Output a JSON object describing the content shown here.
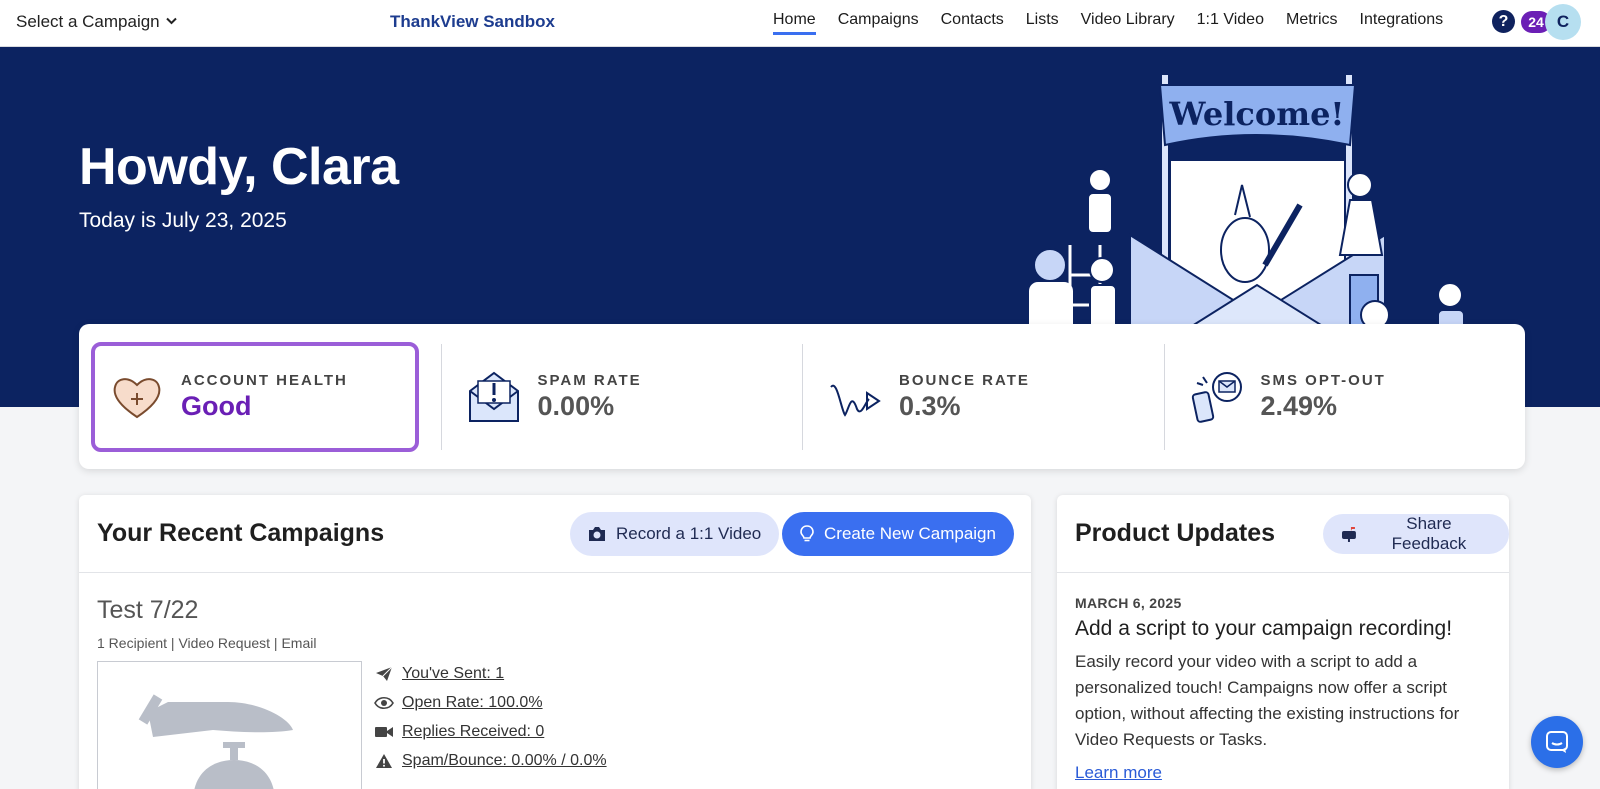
{
  "nav": {
    "campaign_select": "Select a Campaign",
    "brand": "ThankView Sandbox",
    "links": [
      "Home",
      "Campaigns",
      "Contacts",
      "Lists",
      "Video Library",
      "1:1 Video",
      "Metrics",
      "Integrations"
    ],
    "active_link": "Home",
    "help_icon": "?",
    "notification_count": "24",
    "avatar_initial": "C"
  },
  "hero": {
    "greeting": "Howdy, Clara",
    "date": "Today is July 23, 2025",
    "banner_text": "Welcome!"
  },
  "stats": {
    "health": {
      "label": "ACCOUNT HEALTH",
      "value": "Good",
      "icon": "heart-plus-icon"
    },
    "spam": {
      "label": "SPAM RATE",
      "value": "0.00%",
      "icon": "envelope-alert-icon"
    },
    "bounce": {
      "label": "BOUNCE RATE",
      "value": "0.3%",
      "icon": "bounce-arrow-icon"
    },
    "sms": {
      "label": "SMS OPT-OUT",
      "value": "2.49%",
      "icon": "phone-message-icon"
    }
  },
  "campaigns": {
    "title": "Your Recent Campaigns",
    "record_btn": "Record a 1:1 Video",
    "create_btn": "Create New Campaign",
    "item": {
      "name": "Test 7/22",
      "meta": "1 Recipient | Video Request | Email",
      "stats": [
        {
          "icon": "paper-plane-icon",
          "text": " You've Sent: 1 "
        },
        {
          "icon": "eye-icon",
          "text": " Open Rate: 100.0% "
        },
        {
          "icon": "video-camera-icon",
          "text": " Replies Received: 0 "
        },
        {
          "icon": "warning-icon",
          "text": " Spam/Bounce: 0.00% / 0.0% "
        }
      ]
    }
  },
  "updates": {
    "title": "Product Updates",
    "feedback_btn": "Share Feedback",
    "date": "MARCH 6, 2025",
    "headline": "Add a script to your campaign recording!",
    "body": "Easily record your video with a script to add a personalized touch! Campaigns now offer a script option, without affecting the existing instructions for Video Requests or Tasks.",
    "learn_more": "Learn more"
  },
  "colors": {
    "hero_bg": "#0c2361",
    "accent_blue": "#3a6ff0",
    "health_purple": "#6a1fb5",
    "brand_blue": "#1d3c8f"
  }
}
